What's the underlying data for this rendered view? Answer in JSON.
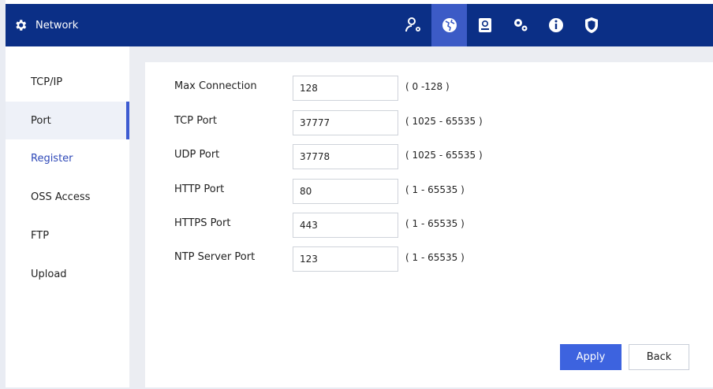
{
  "header": {
    "title": "Network",
    "title_icon": "gear-icon",
    "icons": [
      {
        "name": "account-settings-icon",
        "active": false
      },
      {
        "name": "network-globe-icon",
        "active": true
      },
      {
        "name": "storage-icon",
        "active": false
      },
      {
        "name": "system-settings-icon",
        "active": false
      },
      {
        "name": "info-icon",
        "active": false
      },
      {
        "name": "security-shield-icon",
        "active": false
      }
    ],
    "bar_color": "#0b2f86",
    "active_color": "#3c5bc6"
  },
  "sidebar": {
    "items": [
      {
        "label": "TCP/IP"
      },
      {
        "label": "Port",
        "selected": true
      },
      {
        "label": "Register"
      },
      {
        "label": "OSS Access"
      },
      {
        "label": "FTP"
      },
      {
        "label": "Upload"
      }
    ]
  },
  "form": {
    "rows": [
      {
        "label": "Max Connection",
        "value": "128",
        "range": "( 0 -128 )"
      },
      {
        "label": "TCP Port",
        "value": "37777",
        "range": "( 1025 - 65535 )"
      },
      {
        "label": "UDP Port",
        "value": "37778",
        "range": "( 1025 - 65535 )"
      },
      {
        "label": "HTTP Port",
        "value": "80",
        "range": "( 1 - 65535 )"
      },
      {
        "label": "HTTPS Port",
        "value": "443",
        "range": "( 1 - 65535 )"
      },
      {
        "label": "NTP Server Port",
        "value": "123",
        "range": "( 1 - 65535 )"
      }
    ]
  },
  "buttons": {
    "apply": "Apply",
    "back": "Back"
  },
  "colors": {
    "accent": "#3d63df",
    "selected_bar": "#3d5bd1"
  }
}
